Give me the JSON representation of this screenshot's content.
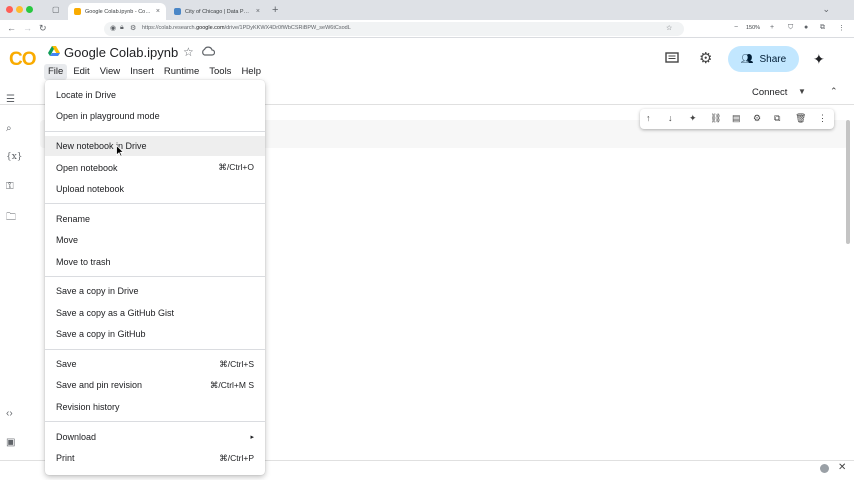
{
  "browser": {
    "tabs": [
      {
        "title": "Google Colab.ipynb - Colab",
        "active": true
      },
      {
        "title": "City of Chicago | Data Portal | C",
        "active": false
      }
    ],
    "url_prefix": "https://colab.research.",
    "url_host": "google.com",
    "url_path": "/drive/1PDyKKWX4Dr0fWbCSRiBPW_seW6tCsodL",
    "zoom": "150%",
    "traffic_colors": [
      "#ff5f57",
      "#febc2e",
      "#28c840"
    ]
  },
  "colab": {
    "logo": "CO",
    "notebook_title": "Google Colab.ipynb",
    "menu": [
      "File",
      "Edit",
      "View",
      "Insert",
      "Runtime",
      "Tools",
      "Help"
    ],
    "share_label": "Share",
    "connect_label": "Connect"
  },
  "file_menu": {
    "groups": [
      [
        {
          "label": "Locate in Drive",
          "shortcut": ""
        },
        {
          "label": "Open in playground mode",
          "shortcut": ""
        }
      ],
      [
        {
          "label": "New notebook in Drive",
          "shortcut": ""
        },
        {
          "label": "Open notebook",
          "shortcut": "⌘/Ctrl+O"
        },
        {
          "label": "Upload notebook",
          "shortcut": ""
        }
      ],
      [
        {
          "label": "Rename",
          "shortcut": ""
        },
        {
          "label": "Move",
          "shortcut": ""
        },
        {
          "label": "Move to trash",
          "shortcut": ""
        }
      ],
      [
        {
          "label": "Save a copy in Drive",
          "shortcut": ""
        },
        {
          "label": "Save a copy as a GitHub Gist",
          "shortcut": ""
        },
        {
          "label": "Save a copy in GitHub",
          "shortcut": ""
        }
      ],
      [
        {
          "label": "Save",
          "shortcut": "⌘/Ctrl+S"
        },
        {
          "label": "Save and pin revision",
          "shortcut": "⌘/Ctrl+M S"
        },
        {
          "label": "Revision history",
          "shortcut": ""
        }
      ],
      [
        {
          "label": "Download",
          "shortcut": "▸"
        },
        {
          "label": "Print",
          "shortcut": "⌘/Ctrl+P"
        }
      ]
    ],
    "hovered": "New notebook in Drive"
  },
  "icons": {
    "sidebar": [
      "table-of-contents-icon",
      "find-icon",
      "variables-icon",
      "secrets-key-icon",
      "files-folder-icon",
      "code-snippets-icon",
      "terminal-icon"
    ],
    "cell_toolbar": [
      "move-up-icon",
      "move-down-icon",
      "gemini-icon",
      "link-icon",
      "comment-icon",
      "settings-icon",
      "mirror-cell-icon",
      "delete-icon",
      "more-vert-icon"
    ]
  }
}
